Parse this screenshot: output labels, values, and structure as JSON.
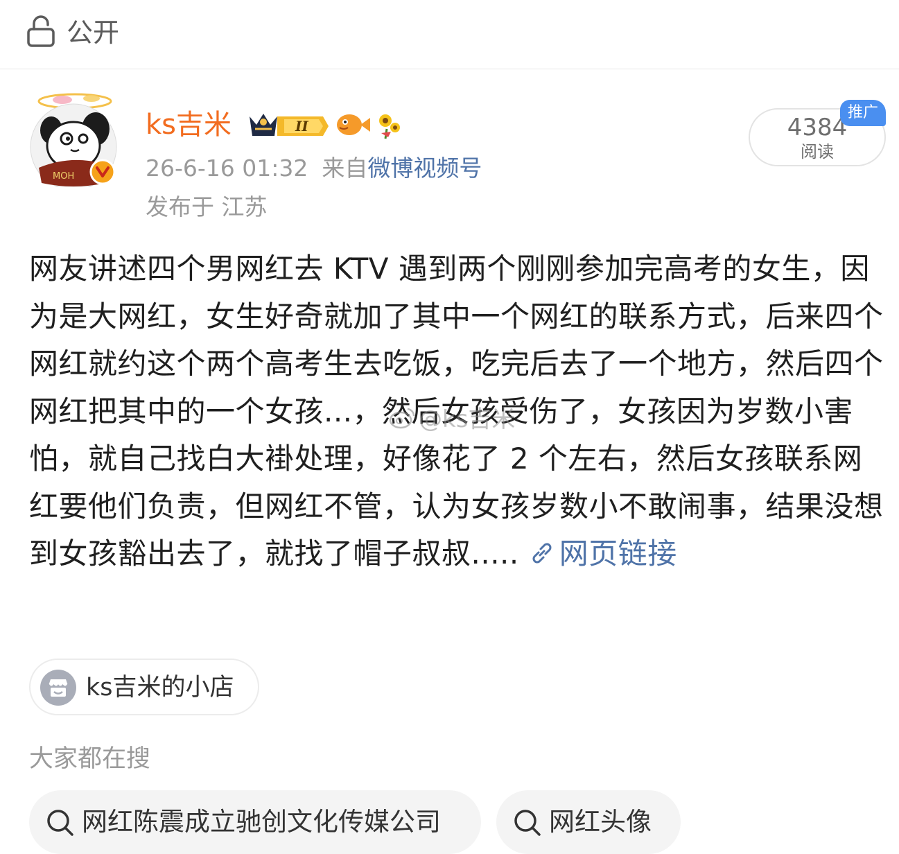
{
  "topbar": {
    "visibility_icon": "unlock-icon",
    "visibility_label": "公开"
  },
  "post": {
    "author_name": "ks吉米",
    "avatar_icon": "panda-avatar-icon",
    "verified_badge_icon": "verified-v-icon",
    "badge_icons": [
      "crown-level-ii-icon",
      "fish-icon",
      "sunflower-icon"
    ],
    "badge_level_text": "II",
    "timestamp": "26-6-16 01:32",
    "source_prefix": "来自",
    "source_name": "微博视频号",
    "location": "发布于 江苏",
    "read_count": "4384",
    "read_label": "阅读",
    "promo_badge": "推广",
    "body": "网友讲述四个男网红去 KTV 遇到两个刚刚参加完高考的女生，因为是大网红，女生好奇就加了其中一个网红的联系方式，后来四个网红就约这个两个高考生去吃饭，吃完后去了一个地方，然后四个网红把其中的一个女孩...，然后女孩受伤了，女孩因为岁数小害怕，就自己找白大褂处理，好像花了 2 个左右，然后女孩联系网红要他们负责，但网红不管，认为女孩岁数小不敢闹事，结果没想到女孩豁出去了，就找了帽子叔叔.....",
    "link_icon": "link-icon",
    "web_link_label": "网页链接",
    "watermark": "@ks吉米"
  },
  "shop": {
    "icon": "shop-icon",
    "label": "ks吉米的小店"
  },
  "search": {
    "header": "大家都在搜",
    "icon": "search-icon",
    "chips": [
      "网红陈震成立驰创文化传媒公司",
      "网红头像"
    ]
  },
  "colors": {
    "author_name": "#f26c1f",
    "link": "#4f73a8",
    "promo_badge": "#4a8ff0",
    "meta_text": "#9a9a9a"
  }
}
